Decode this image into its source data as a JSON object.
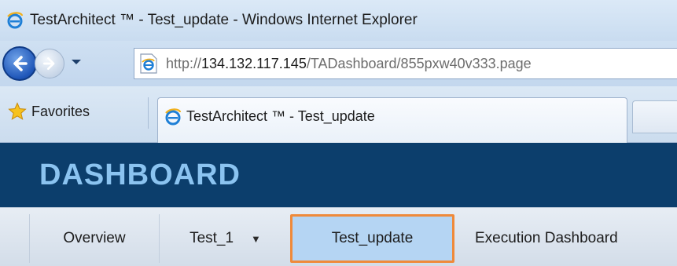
{
  "window": {
    "title": "TestArchitect ™ - Test_update - Windows Internet Explorer",
    "icon": "ie-icon"
  },
  "navigation": {
    "back_icon": "back-arrow-icon",
    "forward_icon": "forward-arrow-icon",
    "history_icon": "chevron-down-icon",
    "address": {
      "scheme": "http://",
      "host": "134.132.117.145",
      "path": "/TADashboard/855pxw40v333.page",
      "page_icon": "ie-page-icon"
    }
  },
  "tabs_bar": {
    "favorites_label": "Favorites",
    "favorites_icon": "star-icon",
    "active_tab_title": "TestArchitect ™ - Test_update"
  },
  "dashboard": {
    "brand": "DASHBOARD",
    "brand_color": "#8bc3f0",
    "header_color": "#0c3e6c",
    "menu": [
      {
        "label": "Overview"
      },
      {
        "label": "Test_1",
        "has_dropdown": true
      },
      {
        "label": "Test_update",
        "selected": true
      },
      {
        "label": "Execution Dashboard"
      }
    ],
    "highlight_color": "#ef8a3a"
  }
}
